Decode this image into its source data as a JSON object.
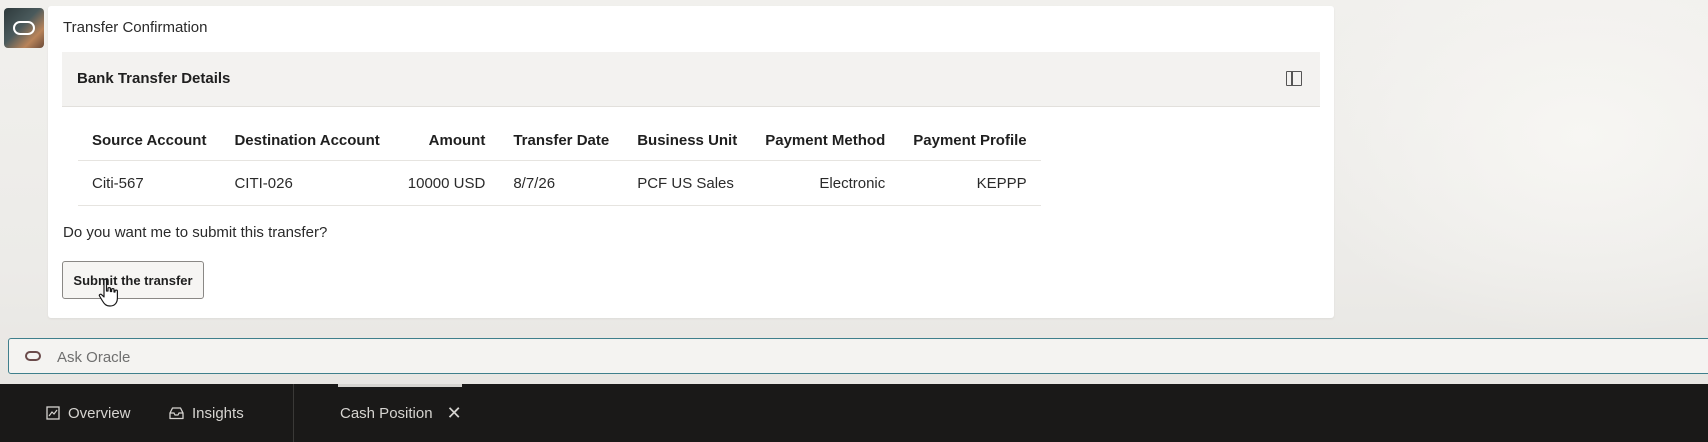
{
  "card": {
    "title": "Transfer Confirmation",
    "panel_title": "Bank Transfer Details",
    "table": {
      "headers": [
        "Source Account",
        "Destination Account",
        "Amount",
        "Transfer Date",
        "Business Unit",
        "Payment Method",
        "Payment Profile"
      ],
      "rows": [
        [
          "Citi-567",
          "CITI-026",
          "10000 USD",
          "8/7/26",
          "PCF US Sales",
          "Electronic",
          "KEPPP"
        ]
      ]
    },
    "prompt": "Do you want me to submit this transfer?",
    "submit_label": "Submit the transfer"
  },
  "ask": {
    "placeholder": "Ask Oracle"
  },
  "bottom_nav": {
    "tabs": [
      {
        "label": "Overview",
        "icon": "overview-icon"
      },
      {
        "label": "Insights",
        "icon": "insights-icon"
      }
    ],
    "open_tab": {
      "label": "Cash Position",
      "icon": "close-icon"
    }
  },
  "colors": {
    "accent_border": "#3f7f8c",
    "bottom_bar": "#1a1918"
  }
}
